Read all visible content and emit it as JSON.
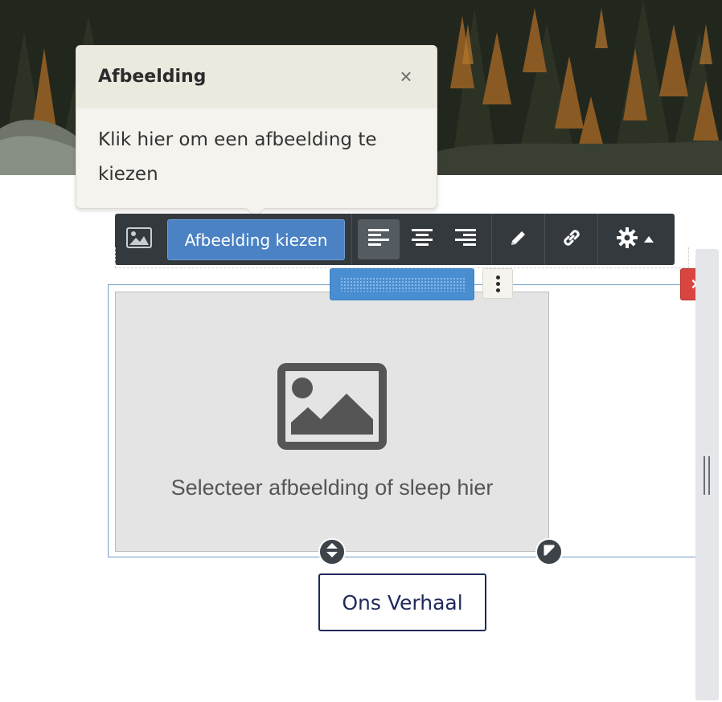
{
  "tooltip": {
    "title": "Afbeelding",
    "close_symbol": "×",
    "body": "Klik hier om een afbeelding te kiezen"
  },
  "toolbar": {
    "image_icon": "image-icon",
    "choose_label": "Afbeelding kiezen",
    "align_buttons": [
      "align-left-icon",
      "align-center-icon",
      "align-right-icon"
    ],
    "active_align": "align-left",
    "edit_icon": "pencil-icon",
    "link_icon": "link-icon",
    "settings_icon": "gear-icon",
    "settings_caret": "caret-up-icon"
  },
  "block": {
    "placeholder_text": "Selecteer afbeelding of sleep hier",
    "placeholder_icon": "image-placeholder-icon",
    "delete_symbol": "×"
  },
  "cta": {
    "label": "Ons Verhaal"
  },
  "colors": {
    "toolbar_bg": "#34393e",
    "primary_button": "#4a82c4",
    "delete_button": "#d9463f",
    "cta_border": "#1f2a5a",
    "tooltip_bg": "#f4f3ee"
  }
}
